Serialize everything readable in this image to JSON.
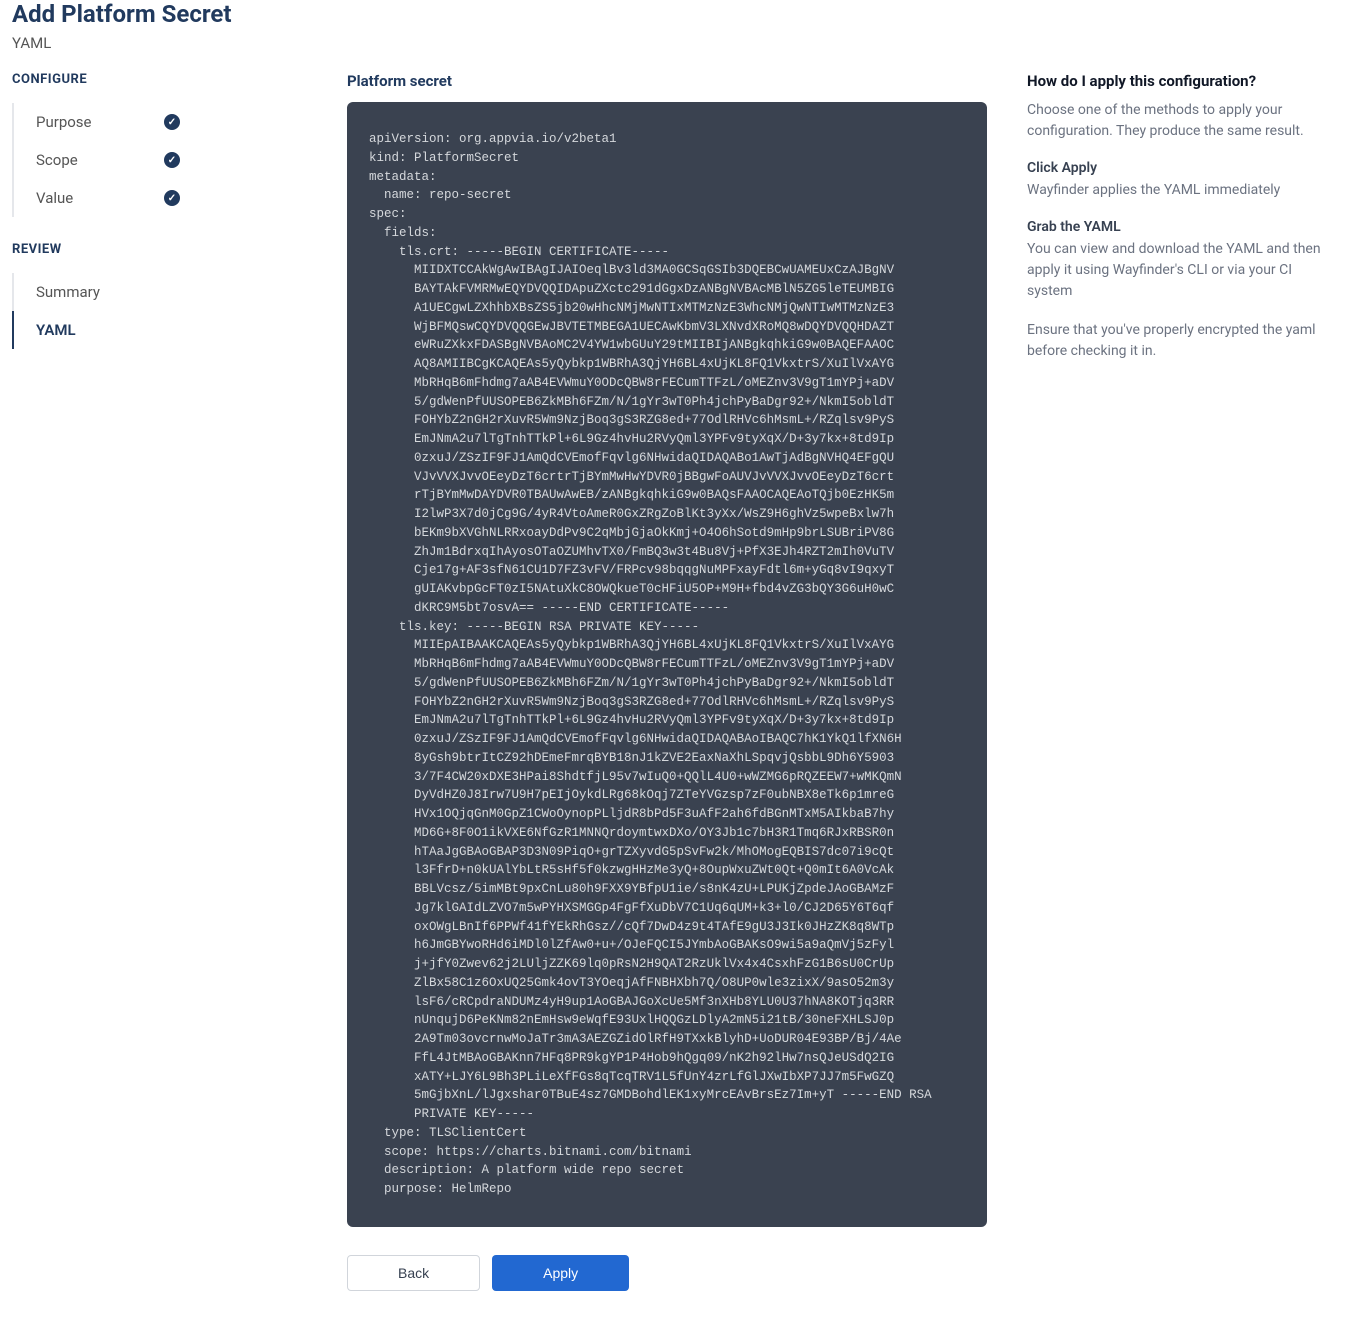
{
  "header": {
    "title": "Add Platform Secret",
    "subtitle": "YAML"
  },
  "sidebar": {
    "configure_label": "CONFIGURE",
    "review_label": "REVIEW",
    "configure_items": [
      {
        "label": "Purpose",
        "checked": true
      },
      {
        "label": "Scope",
        "checked": true
      },
      {
        "label": "Value",
        "checked": true
      }
    ],
    "review_items": [
      {
        "label": "Summary",
        "active": false
      },
      {
        "label": "YAML",
        "active": true
      }
    ]
  },
  "main": {
    "title": "Platform secret",
    "yaml": "apiVersion: org.appvia.io/v2beta1\nkind: PlatformSecret\nmetadata:\n  name: repo-secret\nspec:\n  fields:\n    tls.crt: -----BEGIN CERTIFICATE-----\n      MIIDXTCCAkWgAwIBAgIJAIOeqlBv3ld3MA0GCSqGSIb3DQEBCwUAMEUxCzAJBgNV\n      BAYTAkFVMRMwEQYDVQQIDApuZXctc291dGgxDzANBgNVBAcMBlN5ZG5leTEUMBIG\n      A1UECgwLZXhhbXBsZS5jb20wHhcNMjMwNTIxMTMzNzE3WhcNMjQwNTIwMTMzNzE3\n      WjBFMQswCQYDVQQGEwJBVTETMBEGA1UECAwKbmV3LXNvdXRoMQ8wDQYDVQQHDAZT\n      eWRuZXkxFDASBgNVBAoMC2V4YW1wbGUuY29tMIIBIjANBgkqhkiG9w0BAQEFAAOC\n      AQ8AMIIBCgKCAQEAs5yQybkp1WBRhA3QjYH6BL4xUjKL8FQ1VkxtrS/XuIlVxAYG\n      MbRHqB6mFhdmg7aAB4EVWmuY0ODcQBW8rFECumTTFzL/oMEZnv3V9gT1mYPj+aDV\n      5/gdWenPfUUSOPEB6ZkMBh6FZm/N/1gYr3wT0Ph4jchPyBaDgr92+/NkmI5obldT\n      FOHYbZ2nGH2rXuvR5Wm9NzjBoq3gS3RZG8ed+77OdlRHVc6hMsmL+/RZqlsv9PyS\n      EmJNmA2u7lTgTnhTTkPl+6L9Gz4hvHu2RVyQml3YPFv9tyXqX/D+3y7kx+8td9Ip\n      0zxuJ/ZSzIF9FJ1AmQdCVEmofFqvlg6NHwidaQIDAQABo1AwTjAdBgNVHQ4EFgQU\n      VJvVVXJvvOEeyDzT6crtrTjBYmMwHwYDVR0jBBgwFoAUVJvVVXJvvOEeyDzT6crt\n      rTjBYmMwDAYDVR0TBAUwAwEB/zANBgkqhkiG9w0BAQsFAAOCAQEAoTQjb0EzHK5m\n      I2lwP3X7d0jCg9G/4yR4VtoAmeR0GxZRgZoBlKt3yXx/WsZ9H6ghVz5wpeBxlw7h\n      bEKm9bXVGhNLRRxoayDdPv9C2qMbjGjaOkKmj+O4O6hSotd9mHp9brLSUBriPV8G\n      ZhJm1BdrxqIhAyosOTaOZUMhvTX0/FmBQ3w3t4Bu8Vj+PfX3EJh4RZT2mIh0VuTV\n      Cje17g+AF3sfN61CU1D7FZ3vFV/FRPcv98bqqgNuMPFxayFdtl6m+yGq8vI9qxyT\n      gUIAKvbpGcFT0zI5NAtuXkC8OWQkueT0cHFiU5OP+M9H+fbd4vZG3bQY3G6uH0wC\n      dKRC9M5bt7osvA== -----END CERTIFICATE-----\n    tls.key: -----BEGIN RSA PRIVATE KEY-----\n      MIIEpAIBAAKCAQEAs5yQybkp1WBRhA3QjYH6BL4xUjKL8FQ1VkxtrS/XuIlVxAYG\n      MbRHqB6mFhdmg7aAB4EVWmuY0ODcQBW8rFECumTTFzL/oMEZnv3V9gT1mYPj+aDV\n      5/gdWenPfUUSOPEB6ZkMBh6FZm/N/1gYr3wT0Ph4jchPyBaDgr92+/NkmI5obldT\n      FOHYbZ2nGH2rXuvR5Wm9NzjBoq3gS3RZG8ed+77OdlRHVc6hMsmL+/RZqlsv9PyS\n      EmJNmA2u7lTgTnhTTkPl+6L9Gz4hvHu2RVyQml3YPFv9tyXqX/D+3y7kx+8td9Ip\n      0zxuJ/ZSzIF9FJ1AmQdCVEmofFqvlg6NHwidaQIDAQABAoIBAQC7hK1YkQ1lfXN6H\n      8yGsh9btrItCZ92hDEmeFmrqBYB18nJ1kZVE2EaxNaXhLSpqvjQsbbL9Dh6Y5903\n      3/7F4CW20xDXE3HPai8ShdtfjL95v7wIuQ0+QQlL4U0+wWZMG6pRQZEEW7+wMKQmN\n      DyVdHZ0J8Irw7U9H7pEIjOykdLRg68kOqj7ZTeYVGzsp7zF0ubNBX8eTk6p1mreG\n      HVx1OQjqGnM0GpZ1CWoOynopPLljdR8bPd5F3uAfF2ah6fdBGnMTxM5AIkbaB7hy\n      MD6G+8F0O1ikVXE6NfGzR1MNNQrdoymtwxDXo/OY3Jb1c7bH3R1Tmq6RJxRBSR0n\n      hTAaJgGBAoGBAP3D3N09PiqO+grTZXyvdG5pSvFw2k/MhOMogEQBIS7dc07i9cQt\n      l3FfrD+n0kUAlYbLtR5sHf5f0kzwgHHzMe3yQ+8OupWxuZWt0Qt+Q0mIt6A0VcAk\n      BBLVcsz/5imMBt9pxCnLu80h9FXX9YBfpU1ie/s8nK4zU+LPUKjZpdeJAoGBAMzF\n      Jg7klGAIdLZVO7m5wPYHXSMGGp4FgFfXuDbV7C1Uq6qUM+k3+l0/CJ2D65Y6T6qf\n      oxOWgLBnIf6PPWf41fYEkRhGsz//cQf7DwD4z9t4TAfE9gU3J3Ik0JHzZK8q8WTp\n      h6JmGBYwoRHd6iMDl0lZfAw0+u+/OJeFQCI5JYmbAoGBAKsO9wi5a9aQmVj5zFyl\n      j+jfY0Zwev62j2LUljZZK69lq0pRsN2H9QAT2RzUklVx4x4CsxhFzG1B6sU0CrUp\n      ZlBx58C1z6OxUQ25Gmk4ovT3YOeqjAfFNBHXbh7Q/O8UP0wle3zixX/9asO52m3y\n      lsF6/cRCpdraNDUMz4yH9up1AoGBAJGoXcUe5Mf3nXHb8YLU0U37hNA8KOTjq3RR\n      nUnqujD6PeKNm82nEmHsw9eWqfE93UxlHQQGzLDlyA2mN5i21tB/30neFXHLSJ0p\n      2A9Tm03ovcrnwMoJaTr3mA3AEZGZidOlRfH9TXxkBlyhD+UoDUR04E93BP/Bj/4Ae\n      FfL4JtMBAoGBAKnn7HFq8PR9kgYP1P4Hob9hQgq09/nK2h92lHw7nsQJeUSdQ2IG\n      xATY+LJY6L9Bh3PLiLeXfFGs8qTcqTRV1L5fUnY4zrLfGlJXwIbXP7JJ7m5FwGZQ\n      5mGjbXnL/lJgxshar0TBuE4sz7GMDBohdlEK1xyMrcEAvBrsEz7Im+yT -----END RSA\n      PRIVATE KEY-----\n  type: TLSClientCert\n  scope: https://charts.bitnami.com/bitnami\n  description: A platform wide repo secret\n  purpose: HelmRepo",
    "back_label": "Back",
    "apply_label": "Apply"
  },
  "right": {
    "title": "How do I apply this configuration?",
    "intro": "Choose one of the methods to apply your configuration. They produce the same result.",
    "sections": [
      {
        "title": "Click Apply",
        "text": "Wayfinder applies the YAML immediately"
      },
      {
        "title": "Grab the YAML",
        "text": "You can view and download the YAML and then apply it using Wayfinder's CLI or via your CI system"
      }
    ],
    "footer": "Ensure that you've properly encrypted the yaml before checking it in."
  }
}
